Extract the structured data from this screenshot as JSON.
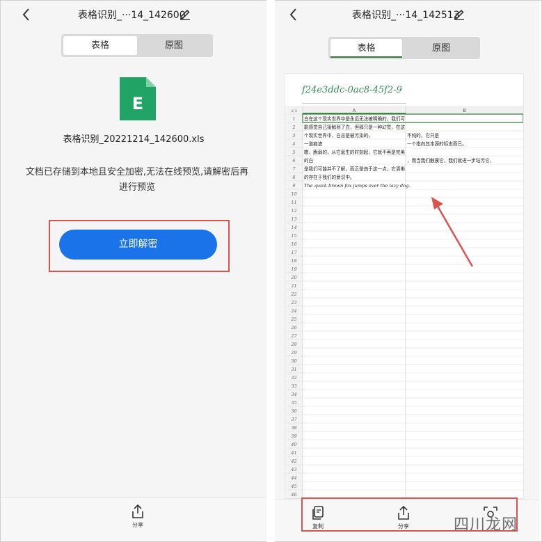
{
  "left": {
    "title": "表格识别_···14_142600",
    "tabs": [
      {
        "label": "表格",
        "active": true
      },
      {
        "label": "原图",
        "active": false
      }
    ],
    "file_icon_letter": "E",
    "file_name": "表格识别_20221214_142600.xls",
    "notice": "文档已存储到本地且安全加密,无法在线预览,请解密后再进行预览",
    "decrypt_button": "立即解密",
    "bottom": {
      "share_label": "分享"
    }
  },
  "right": {
    "title": "表格识别_···14_142513",
    "tabs": [
      {
        "label": "表格",
        "active": true
      },
      {
        "label": "原图",
        "active": false
      }
    ],
    "sheet_title": "f24e3ddc-0ac8-45f2-9",
    "sheet": {
      "corner": "a/a",
      "col_headers": [
        "A",
        "B"
      ],
      "row_count": 47,
      "cells": [
        {
          "row": 1,
          "col": 0,
          "text": "白在这个现实世界中是永远无法被明确的，我们可"
        },
        {
          "row": 2,
          "col": 0,
          "text": "能感觉自己接触到了白，但那只是一种幻觉，在这"
        },
        {
          "row": 3,
          "col": 0,
          "text": "个现实世界中，白总是被污染的，"
        },
        {
          "row": 3,
          "col": 1,
          "text": "不纯的，它只是"
        },
        {
          "row": 4,
          "col": 0,
          "text": "一道痕迹"
        },
        {
          "row": 4,
          "col": 1,
          "text": "一个指向其本源的标志而已。"
        },
        {
          "row": 5,
          "col": 0,
          "text": "皦、脆弱的，从它诞生的时刻起，它就不再是完美"
        },
        {
          "row": 6,
          "col": 0,
          "text": "的白"
        },
        {
          "row": 6,
          "col": 1,
          "text": "，而当我们触摸它，我们就进一步玷污它，"
        },
        {
          "row": 7,
          "col": 0,
          "text": "是我们可能并不了解，而正是由于这一点，它清晰"
        },
        {
          "row": 8,
          "col": 0,
          "text": "的存在于我们的意识中。"
        },
        {
          "row": 9,
          "col": 0,
          "text": "The quick brown fox jumps over the lazy dog."
        }
      ]
    },
    "bottom": {
      "copy_label": "复制",
      "share_label": "分享",
      "third_label": ""
    }
  },
  "watermark": "四川龙网",
  "colors": {
    "accent_blue": "#1a73e8",
    "excel_green": "#21a366",
    "annotation_red": "#d9534f"
  }
}
